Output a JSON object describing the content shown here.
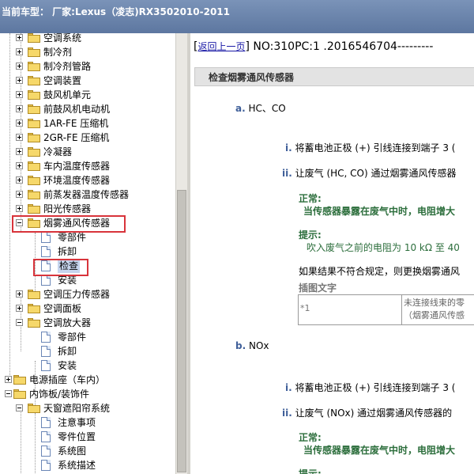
{
  "title_bar": {
    "text": "当前车型：  厂家:Lexus（凌志)RX3502010-2011"
  },
  "tree": {
    "items": [
      {
        "label": "空调系统",
        "indent": 1,
        "type": "folder",
        "exp": "plus"
      },
      {
        "label": "制冷剂",
        "indent": 1,
        "type": "folder",
        "exp": "plus"
      },
      {
        "label": "制冷剂管路",
        "indent": 1,
        "type": "folder",
        "exp": "plus"
      },
      {
        "label": "空调装置",
        "indent": 1,
        "type": "folder",
        "exp": "plus"
      },
      {
        "label": "鼓风机单元",
        "indent": 1,
        "type": "folder",
        "exp": "plus"
      },
      {
        "label": "前鼓风机电动机",
        "indent": 1,
        "type": "folder",
        "exp": "plus"
      },
      {
        "label": "1AR-FE 压缩机",
        "indent": 1,
        "type": "folder",
        "exp": "plus"
      },
      {
        "label": "2GR-FE 压缩机",
        "indent": 1,
        "type": "folder",
        "exp": "plus"
      },
      {
        "label": "冷凝器",
        "indent": 1,
        "type": "folder",
        "exp": "plus"
      },
      {
        "label": "车内温度传感器",
        "indent": 1,
        "type": "folder",
        "exp": "plus"
      },
      {
        "label": "环境温度传感器",
        "indent": 1,
        "type": "folder",
        "exp": "plus"
      },
      {
        "label": "前蒸发器温度传感器",
        "indent": 1,
        "type": "folder",
        "exp": "plus"
      },
      {
        "label": "阳光传感器",
        "indent": 1,
        "type": "folder",
        "exp": "plus"
      },
      {
        "label": "烟雾通风传感器",
        "indent": 1,
        "type": "folder",
        "exp": "minus"
      },
      {
        "label": "零部件",
        "indent": 2,
        "type": "doc"
      },
      {
        "label": "拆卸",
        "indent": 2,
        "type": "doc"
      },
      {
        "label": "检查",
        "indent": 2,
        "type": "doc",
        "selected": true
      },
      {
        "label": "安装",
        "indent": 2,
        "type": "doc"
      },
      {
        "label": "空调压力传感器",
        "indent": 1,
        "type": "folder",
        "exp": "plus"
      },
      {
        "label": "空调面板",
        "indent": 1,
        "type": "folder",
        "exp": "plus"
      },
      {
        "label": "空调放大器",
        "indent": 1,
        "type": "folder",
        "exp": "minus"
      },
      {
        "label": "零部件",
        "indent": 2,
        "type": "doc"
      },
      {
        "label": "拆卸",
        "indent": 2,
        "type": "doc"
      },
      {
        "label": "安装",
        "indent": 2,
        "type": "doc"
      },
      {
        "label": "电源插座（车内）",
        "indent": 0,
        "type": "folder",
        "exp": "plus"
      },
      {
        "label": "内饰板/装饰件",
        "indent": 0,
        "type": "folder",
        "exp": "minus"
      },
      {
        "label": "天窗遮阳帘系统",
        "indent": 1,
        "type": "folder",
        "exp": "minus"
      },
      {
        "label": "注意事项",
        "indent": 2,
        "type": "doc"
      },
      {
        "label": "零件位置",
        "indent": 2,
        "type": "doc"
      },
      {
        "label": "系统图",
        "indent": 2,
        "type": "doc"
      },
      {
        "label": "系统描述",
        "indent": 2,
        "type": "doc"
      }
    ]
  },
  "content": {
    "back_link": "返回上一页",
    "doc_id": "NO:310PC:1 .2016546704---------",
    "section_title": "检查烟雾通风传感器",
    "step_a_label": "a.",
    "step_a_text": "HC、CO",
    "a_i_label": "i.",
    "a_i_text": "将蓄电池正极 (+) 引线连接到端子 3 (",
    "a_ii_label": "ii.",
    "a_ii_text": "让废气 (HC, CO) 通过烟雾通风传感器",
    "normal_label": "正常:",
    "normal_text": "当传感器暴露在废气中时，电阻增大",
    "hint_label": "提示:",
    "hint_text": "吹入废气之前的电阻为 10 kΩ 至 40",
    "replace_text": "如果结果不符合规定，则更换烟雾通风",
    "illus_label": "插图文字",
    "table_c1": "*1",
    "table_c2_line1": "未连接线束的零",
    "table_c2_line2": "（烟雾通风传感",
    "step_b_label": "b.",
    "step_b_text": "NOx",
    "b_i_label": "i.",
    "b_i_text": "将蓄电池正极 (+) 引线连接到端子 3 (",
    "b_ii_label": "ii.",
    "b_ii_text": "让废气 (NOx) 通过烟雾通风传感器的",
    "normal2_label": "正常:",
    "normal2_text": "当传感器暴露在废气中时，电阻增大",
    "hint2_label": "提示:"
  }
}
